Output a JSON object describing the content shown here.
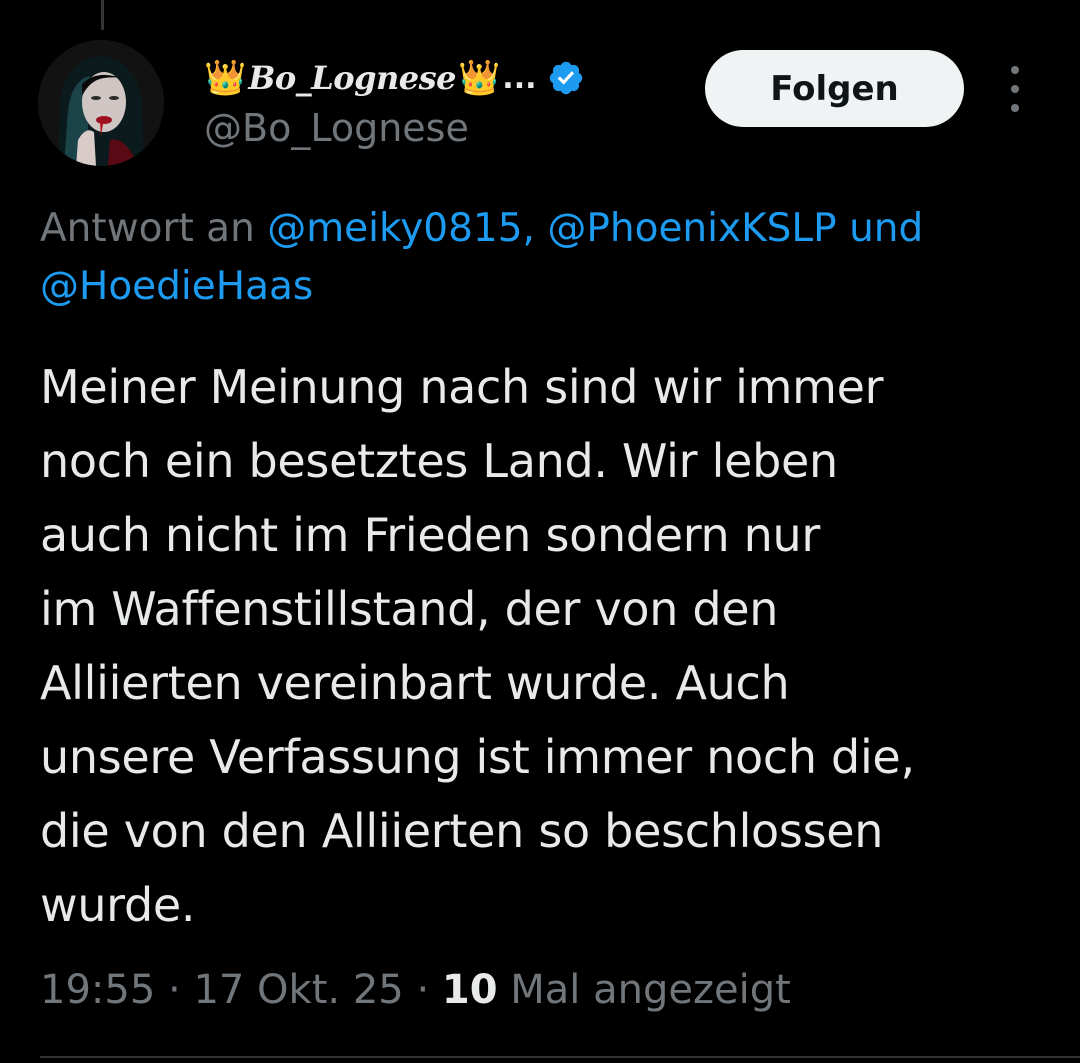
{
  "header": {
    "crown_emoji": "👑",
    "display_name": "Bo_Lognese",
    "truncation": "...",
    "handle": "@Bo_Lognese",
    "follow_label": "Folgen"
  },
  "reply": {
    "prefix": "Antwort an ",
    "mention_1": "@meiky0815,",
    "mention_2": "@PhoenixKSLP",
    "joiner": "und",
    "mention_3": "@HoedieHaas"
  },
  "tweet": {
    "lines": [
      "Meiner Meinung nach sind wir immer",
      "noch ein besetztes Land. Wir leben",
      "auch nicht im Frieden sondern nur",
      "im Waffenstillstand, der von den",
      "Alliierten vereinbart wurde. Auch",
      "unsere Verfassung ist immer noch die,",
      "die von den Alliierten so beschlossen",
      "wurde."
    ]
  },
  "meta": {
    "time": "19:55",
    "separator": "·",
    "date": "17 Okt. 25",
    "view_count": "10",
    "view_label": "Mal angezeigt"
  },
  "colors": {
    "background": "#000000",
    "text": "#e7e9ea",
    "secondary": "#71767b",
    "link": "#1d9bf0",
    "verified": "#1d9bf0",
    "button_bg": "#eff3f4"
  },
  "icons": {
    "verified": "verified-badge-icon",
    "more": "more-options-icon"
  }
}
